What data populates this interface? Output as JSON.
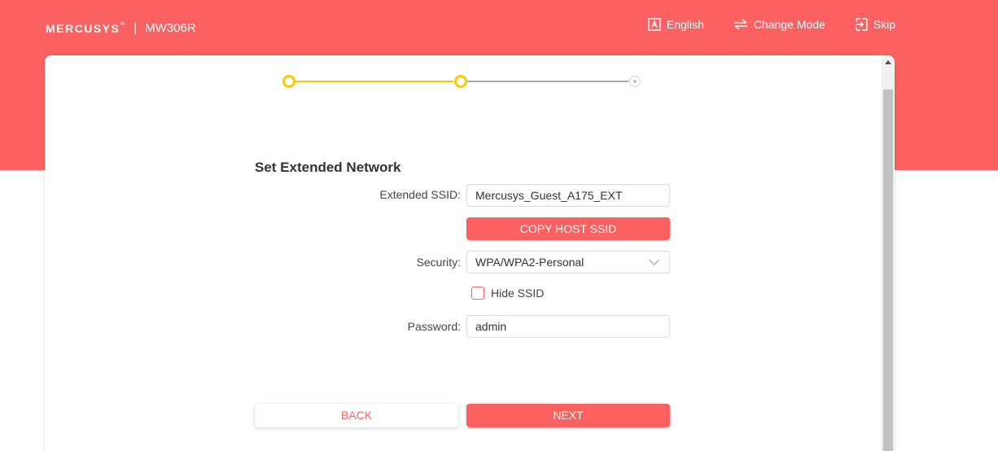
{
  "header": {
    "logo_text": "MERCUSYS",
    "logo_tm": "®",
    "separator": "|",
    "model": "MW306R",
    "actions": [
      {
        "label": "English",
        "icon": "language-icon"
      },
      {
        "label": "Change Mode",
        "icon": "swap-arrows-icon"
      },
      {
        "label": "Skip",
        "icon": "skip-icon"
      }
    ]
  },
  "stepper": {
    "total_steps": 3,
    "completed_steps": 2,
    "active_color": "#ffc900"
  },
  "form": {
    "title": "Set Extended Network",
    "ssid_label": "Extended SSID:",
    "ssid_value": "Mercusys_Guest_A175_EXT",
    "copy_button": "COPY HOST SSID",
    "security_label": "Security:",
    "security_value": "WPA/WPA2-Personal",
    "hide_ssid_label": "Hide SSID",
    "hide_ssid_checked": false,
    "password_label": "Password:",
    "password_value": "admin"
  },
  "buttons": {
    "back": "BACK",
    "next": "NEXT"
  },
  "colors": {
    "brand": "#fb6161",
    "accent": "#ffc900"
  }
}
